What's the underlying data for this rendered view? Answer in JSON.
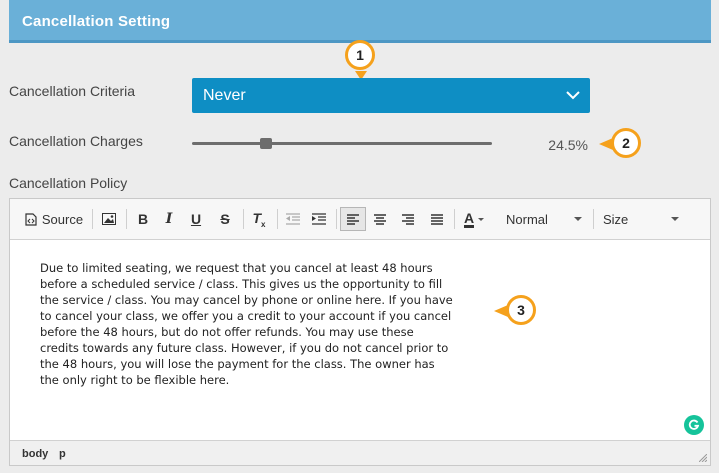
{
  "section": {
    "title": "Cancellation Setting"
  },
  "criteria": {
    "label": "Cancellation Criteria",
    "selected": "Never"
  },
  "charges": {
    "label": "Cancellation Charges",
    "value_text": "24.5%",
    "fraction": 0.245
  },
  "policy": {
    "label": "Cancellation Policy",
    "toolbar": {
      "source_label": "Source",
      "format_value": "Normal",
      "size_value": "Size",
      "icons": [
        "source-icon",
        "image-icon",
        "bold-icon",
        "italic-icon",
        "underline-icon",
        "strikethrough-icon",
        "remove-format-icon",
        "outdent-icon",
        "indent-icon",
        "align-left-icon",
        "align-center-icon",
        "align-right-icon",
        "justify-icon",
        "text-color-icon"
      ]
    },
    "content": "Due to limited seating, we request that you cancel at least 48 hours\nbefore a scheduled service / class. This gives us the opportunity to fill\nthe service / class. You may cancel by phone or online here. If you have\nto cancel your class, we offer you a credit to your account if you cancel\nbefore the 48 hours, but do not offer refunds. You may use these\ncredits towards any future class. However, if you do not cancel prior to\nthe 48 hours, you will lose the payment for the class. The owner has\nthe only right to be flexible here.",
    "status_path": [
      "body",
      "p"
    ]
  },
  "callouts": [
    "1",
    "2",
    "3"
  ],
  "colors": {
    "header": "#6ab0d8",
    "select": "#0e8ec4",
    "callout": "#f5a11c",
    "grammarly": "#15c39a"
  }
}
